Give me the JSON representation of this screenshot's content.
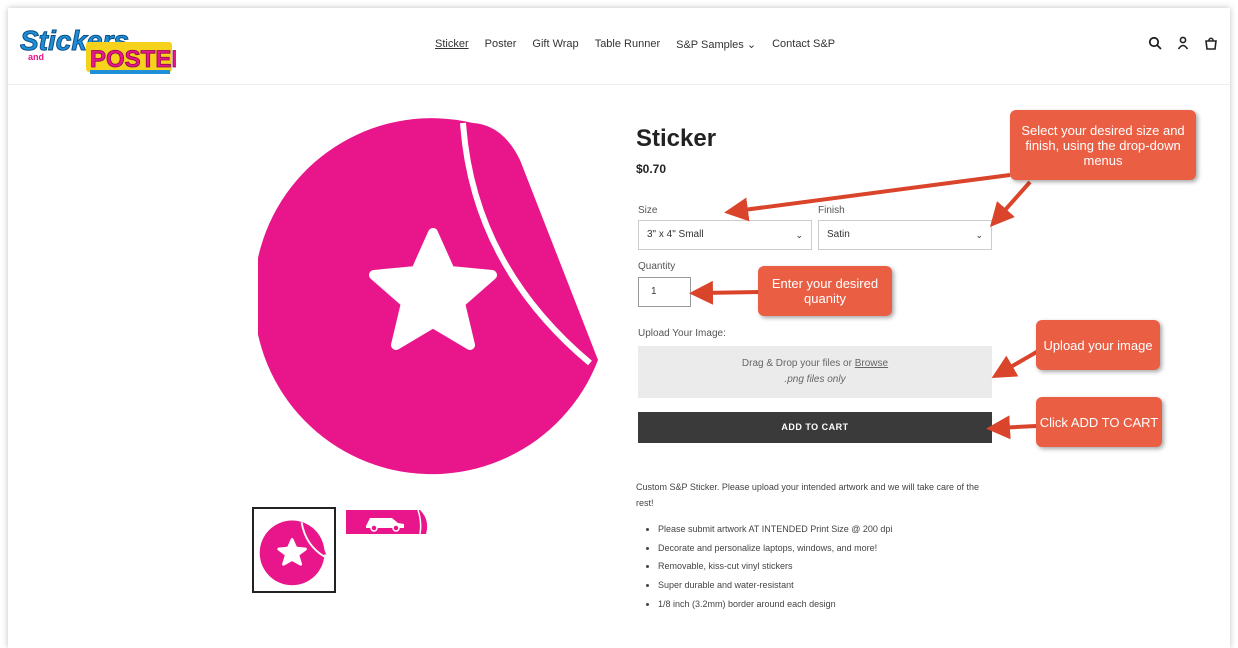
{
  "nav": {
    "items": [
      {
        "label": "Sticker",
        "active": true
      },
      {
        "label": "Poster"
      },
      {
        "label": "Gift Wrap"
      },
      {
        "label": "Table Runner"
      },
      {
        "label": "S&P Samples ⌄"
      },
      {
        "label": "Contact S&P"
      }
    ]
  },
  "product": {
    "title": "Sticker",
    "price": "$0.70",
    "size_label": "Size",
    "size_value": "3\" x 4\" Small",
    "finish_label": "Finish",
    "finish_value": "Satin",
    "quantity_label": "Quantity",
    "quantity_value": "1",
    "upload_label": "Upload Your Image:",
    "drop_text": "Drag & Drop your files or ",
    "browse": "Browse",
    "drop_sub": ".png files only",
    "cart": "ADD TO CART",
    "description": "Custom S&P Sticker. Please upload your intended artwork and we will take care of the rest!",
    "bullets": [
      "Please submit artwork AT INTENDED Print Size @ 200 dpi",
      "Decorate and personalize laptops, windows, and more!",
      "Removable, kiss-cut vinyl stickers",
      "Super durable and water-resistant",
      "1/8 inch (3.2mm) border around each design"
    ]
  },
  "callouts": {
    "size": "Select your desired size and finish, using the drop-down menus",
    "qty": "Enter your desired quanity",
    "upload": "Upload your image",
    "cart": "Click ADD TO CART"
  },
  "colors": {
    "brand_pink": "#e8168a",
    "callout": "#ea5f44",
    "button": "#3a3a3a"
  }
}
